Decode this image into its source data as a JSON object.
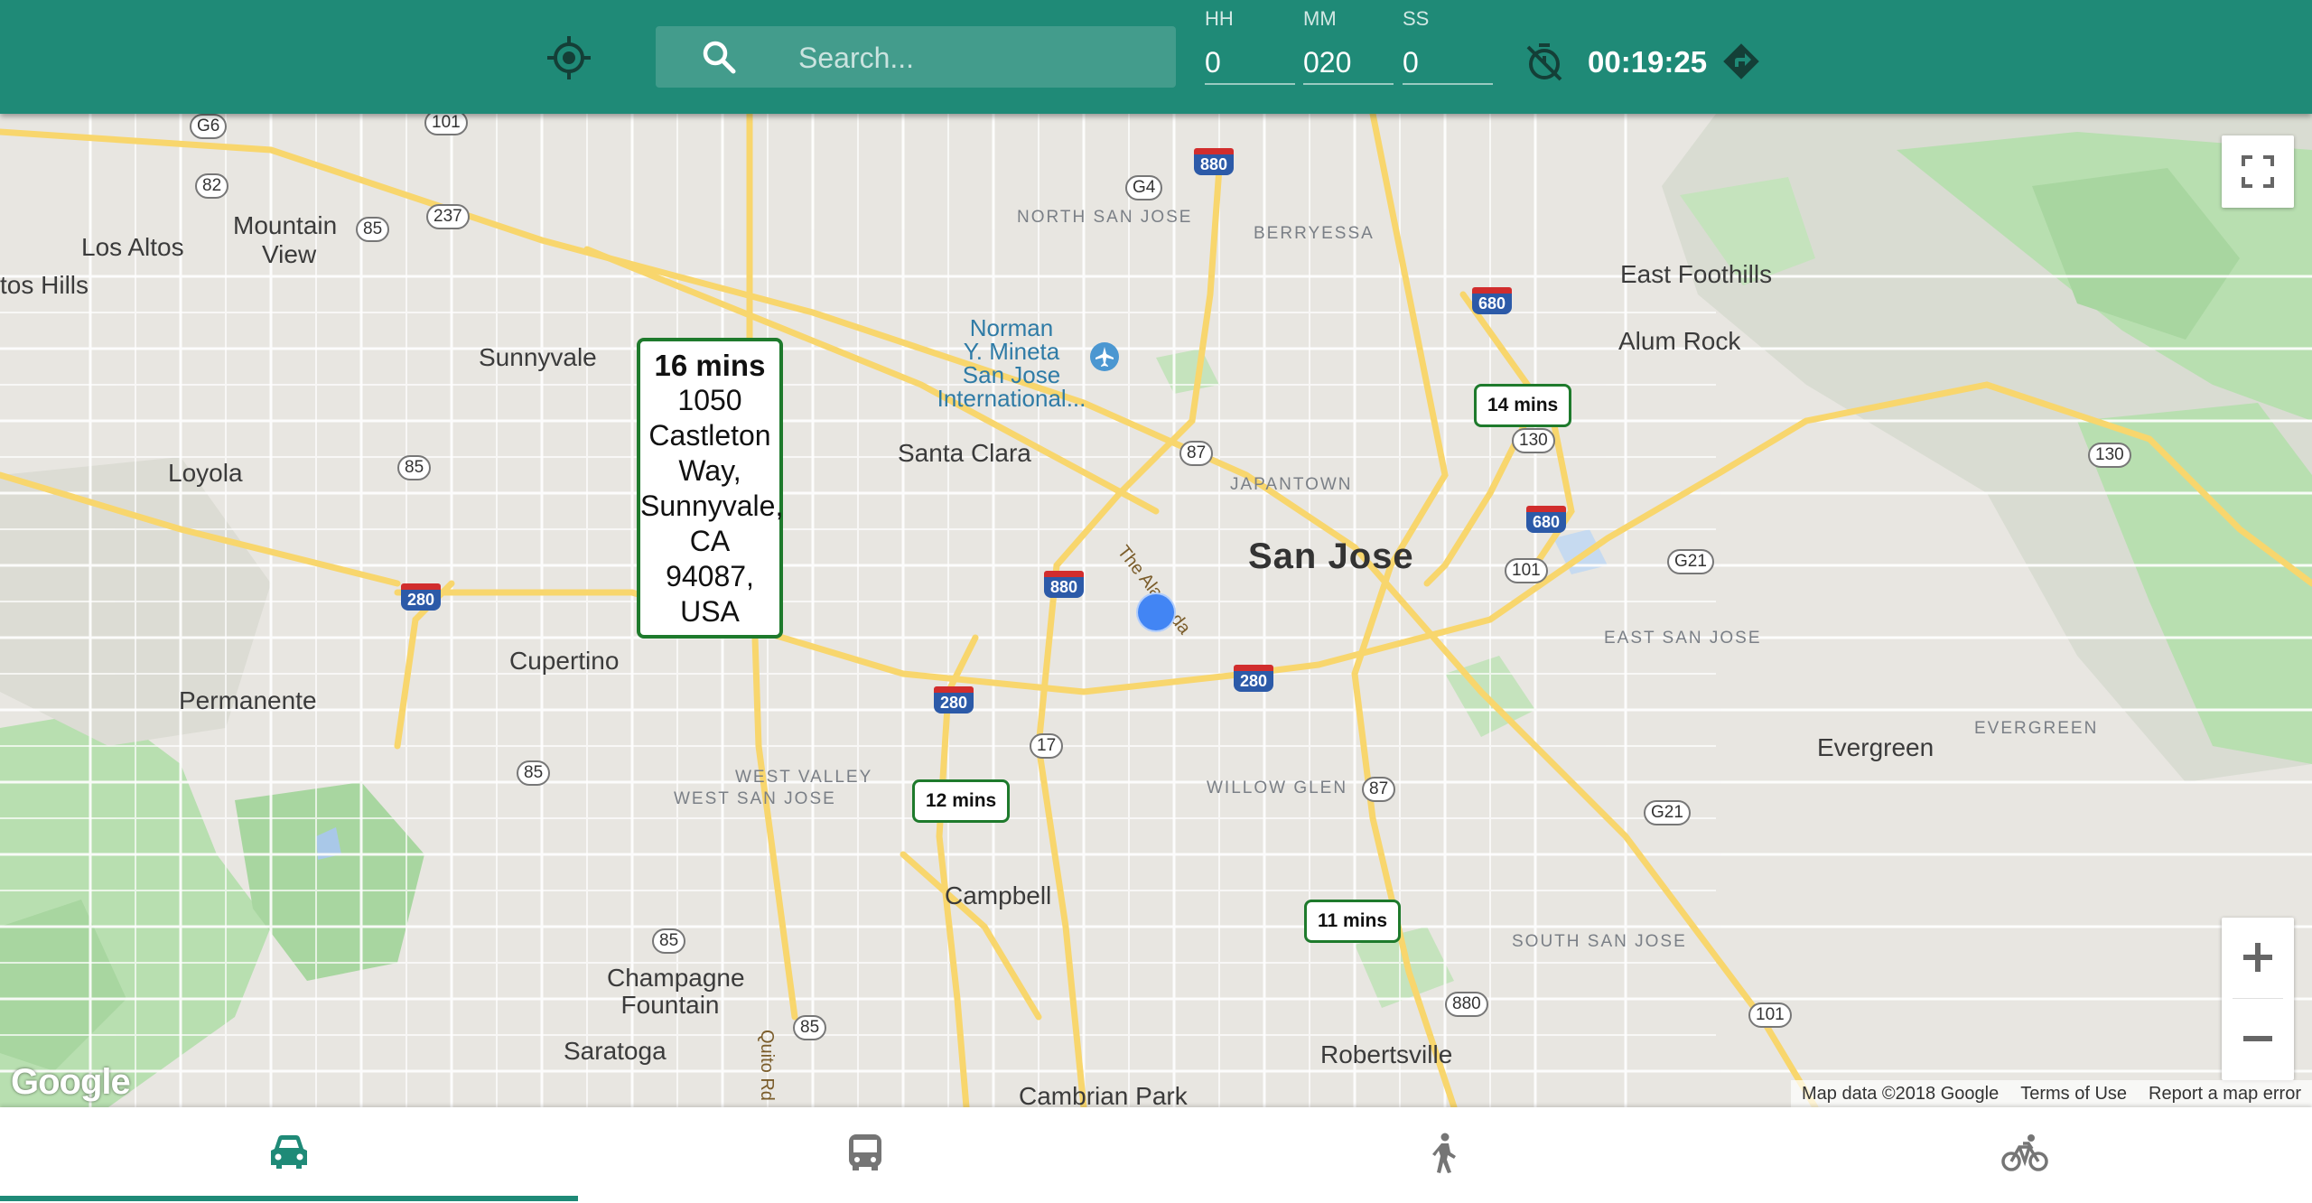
{
  "header": {
    "locate_icon": "crosshair-target-icon",
    "search": {
      "placeholder": "Search...",
      "icon": "search-icon"
    },
    "time_inputs": {
      "hh": {
        "label": "HH",
        "value": "0"
      },
      "mm": {
        "label": "MM",
        "value": "020"
      },
      "ss": {
        "label": "SS",
        "value": "0"
      }
    },
    "timer_icon": "timer-off-icon",
    "timer_value": "00:19:25",
    "directions_icon": "directions-arrow-icon"
  },
  "map": {
    "cities": [
      "Mountain View",
      "Los Altos",
      "tos Hills",
      "Sunnyvale",
      "Santa Clara",
      "Loyola",
      "Cupertino",
      "Permanente",
      "Campbell",
      "Champagne Fountain",
      "Saratoga",
      "Cambrian Park",
      "Robertsville",
      "Evergreen",
      "East Foothills",
      "Alum Rock",
      "Mountain"
    ],
    "main_city": "San Jose",
    "districts": [
      "NORTH SAN JOSE",
      "BERRYESSA",
      "JAPANTOWN",
      "EAST SAN JOSE",
      "EVERGREEN",
      "WEST VALLEY",
      "WEST SAN JOSE",
      "WILLOW GLEN",
      "SOUTH SAN JOSE"
    ],
    "airport": [
      "Norman",
      "Y. Mineta",
      "San Jose",
      "International..."
    ],
    "streets": [
      "The Alameda",
      "Quito Rd"
    ],
    "shields": [
      "G6",
      "101",
      "82",
      "85",
      "237",
      "G4",
      "880",
      "87",
      "130",
      "680",
      "101",
      "G21",
      "280",
      "17",
      "85",
      "G21",
      "87",
      "101",
      "130",
      "85",
      "85",
      "280",
      "280",
      "880",
      "680"
    ],
    "info_box": {
      "mins": "16 mins",
      "address": [
        "1050",
        "Castleton",
        "Way,",
        "Sunnyvale,",
        "CA",
        "94087,",
        "USA"
      ]
    },
    "badges": {
      "b14": "14 mins",
      "b12": "12 mins",
      "b11": "11 mins"
    },
    "user_location_icon": "current-location-dot",
    "fullscreen_icon": "fullscreen-icon",
    "zoom_in_icon": "plus-icon",
    "zoom_out_icon": "minus-icon",
    "logo": "Google",
    "attribution": {
      "data": "Map data ©2018 Google",
      "terms": "Terms of Use",
      "report": "Report a map error"
    }
  },
  "bottom_nav": {
    "tabs": [
      {
        "icon": "car-icon",
        "active": true
      },
      {
        "icon": "bus-icon",
        "active": false
      },
      {
        "icon": "walking-icon",
        "active": false
      },
      {
        "icon": "bicycle-icon",
        "active": false
      }
    ]
  },
  "colors": {
    "header": "#1f8a77",
    "badge_border": "#1e7a2c",
    "user_dot": "#4285f4"
  }
}
